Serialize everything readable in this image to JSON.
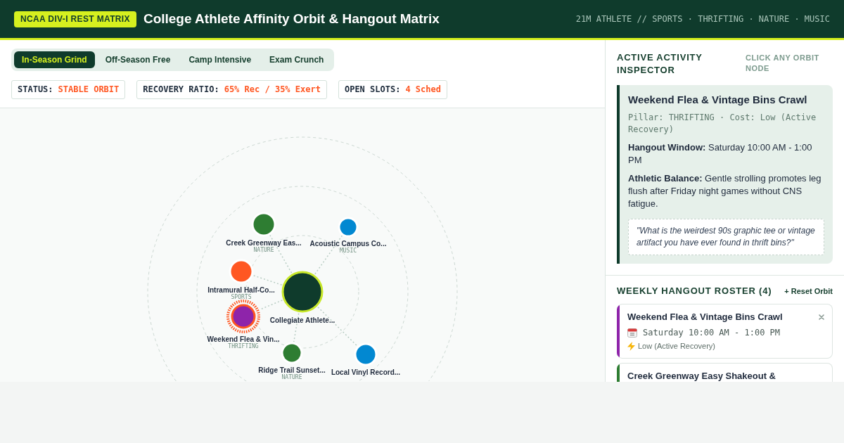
{
  "header": {
    "badge": "NCAA DIV-I REST MATRIX",
    "title": "College Athlete Affinity Orbit & Hangout Matrix",
    "tagline": "21M ATHLETE // SPORTS · THRIFTING · NATURE · MUSIC"
  },
  "tabs": [
    {
      "label": "In-Season Grind",
      "selected": true
    },
    {
      "label": "Off-Season Free",
      "selected": false
    },
    {
      "label": "Camp Intensive",
      "selected": false
    },
    {
      "label": "Exam Crunch",
      "selected": false
    }
  ],
  "stats": [
    {
      "label": "STATUS:",
      "value": "STABLE ORBIT"
    },
    {
      "label": "RECOVERY RATIO:",
      "value": "65% Rec / 35% Exert"
    },
    {
      "label": "OPEN SLOTS:",
      "value": "4 Sched"
    }
  ],
  "orbit": {
    "hub": {
      "label": "Collegiate Athlete..."
    },
    "nodes": [
      {
        "label": "Creek Greenway Eas...",
        "pillar": "NATURE",
        "color": "#2e7d32",
        "selected": false
      },
      {
        "label": "Acoustic Campus Co...",
        "pillar": "MUSIC",
        "color": "#0288d1",
        "selected": false
      },
      {
        "label": "Intramural Half-Co...",
        "pillar": "SPORTS",
        "color": "#ff5722",
        "selected": false
      },
      {
        "label": "Weekend Flea & Vin...",
        "pillar": "THRIFTING",
        "color": "#8e24aa",
        "selected": true
      },
      {
        "label": "Ridge Trail Sunset...",
        "pillar": "NATURE",
        "color": "#2e7d32",
        "selected": false
      },
      {
        "label": "Local Vinyl Record...",
        "color": "#0288d1",
        "selected": false
      }
    ]
  },
  "inspector": {
    "title": "ACTIVE ACTIVITY INSPECTOR",
    "hint": "CLICK ANY ORBIT NODE",
    "activity": {
      "name": "Weekend Flea & Vintage Bins Crawl",
      "meta": "Pillar: THRIFTING · Cost: Low (Active Recovery)",
      "details": [
        "**Hangout Window:** Saturday 10:00 AM - 1:00 PM",
        "**Athletic Balance:** Gentle strolling promotes leg flush after Friday night games without CNS fatigue."
      ],
      "prompt": "\"What is the weirdest 90s graphic tee or vintage artifact you have ever found in thrift bins?\""
    }
  },
  "roster": {
    "title": "WEEKLY HANGOUT ROSTER (4)",
    "reset": "+ Reset Orbit",
    "items": [
      {
        "name": "Weekend Flea & Vintage Bins Crawl",
        "time": "Saturday 10:00 AM - 1:00 PM",
        "cost": "Low (Active Recovery)",
        "color": "#8e24aa",
        "removable": true
      },
      {
        "name": "Creek Greenway Easy Shakeout &",
        "color": "#2e7d32",
        "removable": false
      }
    ]
  }
}
